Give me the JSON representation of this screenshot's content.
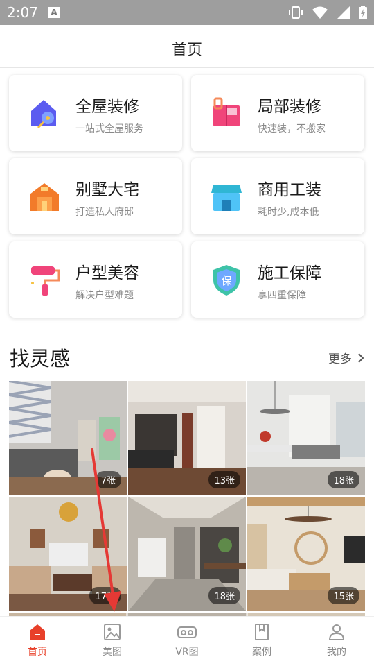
{
  "status_bar": {
    "time": "2:07",
    "badge": "A",
    "icons": [
      "vibrate-icon",
      "wifi-icon",
      "signal-icon",
      "battery-icon"
    ]
  },
  "header": {
    "title": "首页"
  },
  "services": [
    {
      "title": "全屋装修",
      "subtitle": "一站式全屋服务",
      "icon": "house-key-icon"
    },
    {
      "title": "局部装修",
      "subtitle": "快速装，不搬家",
      "icon": "cabinet-icon"
    },
    {
      "title": "别墅大宅",
      "subtitle": "打造私人府邸",
      "icon": "villa-icon"
    },
    {
      "title": "商用工装",
      "subtitle": "耗时少,成本低",
      "icon": "shop-icon"
    },
    {
      "title": "户型美容",
      "subtitle": "解决户型难题",
      "icon": "paint-roller-icon"
    },
    {
      "title": "施工保障",
      "subtitle": "享四重保障",
      "icon": "shield-icon"
    }
  ],
  "inspiration": {
    "title": "找灵感",
    "more_label": "更多",
    "photos": [
      {
        "count": "7张"
      },
      {
        "count": "13张"
      },
      {
        "count": "18张"
      },
      {
        "count": "17张"
      },
      {
        "count": "18张"
      },
      {
        "count": "15张"
      }
    ]
  },
  "bottom_nav": [
    {
      "label": "首页",
      "icon": "home-icon",
      "active": true
    },
    {
      "label": "美图",
      "icon": "image-icon",
      "active": false
    },
    {
      "label": "VR图",
      "icon": "vr-headset-icon",
      "active": false
    },
    {
      "label": "案例",
      "icon": "book-icon",
      "active": false
    },
    {
      "label": "我的",
      "icon": "user-icon",
      "active": false
    }
  ],
  "colors": {
    "accent": "#e8402a",
    "status_bar": "#9e9e9e",
    "annotation_arrow": "#e53935"
  }
}
